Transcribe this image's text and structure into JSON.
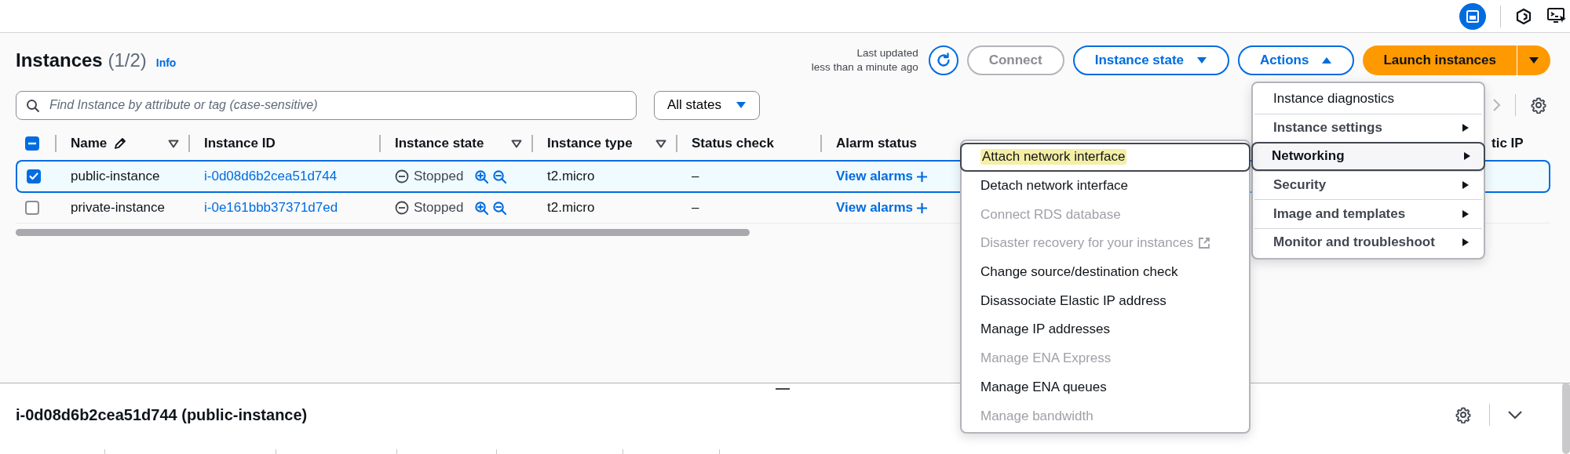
{
  "header": {
    "title": "Instances",
    "count": "(1/2)",
    "info": "Info",
    "last_updated": [
      "Last updated",
      "less than a minute ago"
    ]
  },
  "toolbar": {
    "connect": {
      "label": "Connect",
      "disabled": true
    },
    "instance_state": {
      "label": "Instance state",
      "expanded": false
    },
    "actions": {
      "label": "Actions",
      "expanded": true
    },
    "launch": {
      "label": "Launch instances"
    }
  },
  "search": {
    "placeholder": "Find Instance by attribute or tag (case-sensitive)"
  },
  "filter": {
    "label": "All states"
  },
  "table": {
    "select_all": {
      "indeterminate": true
    },
    "columns": [
      {
        "label": "Name",
        "sortable": true,
        "editable": true
      },
      {
        "label": "Instance ID",
        "sortable": false,
        "editable": false
      },
      {
        "label": "Instance state",
        "sortable": true,
        "editable": false
      },
      {
        "label": "Instance type",
        "sortable": true,
        "editable": false
      },
      {
        "label": "Status check",
        "sortable": false,
        "editable": false
      },
      {
        "label": "Alarm status",
        "sortable": false,
        "editable": false
      },
      {
        "label": "tic IP",
        "sortable": false,
        "editable": false
      }
    ],
    "rows": [
      {
        "selected": true,
        "name": "public-instance",
        "instance_id": "i-0d08d6b2cea51d744",
        "state": "Stopped",
        "type": "t2.micro",
        "status_check": "–",
        "alarm": "View alarms"
      },
      {
        "selected": false,
        "name": "private-instance",
        "instance_id": "i-0e161bbb37371d7ed",
        "state": "Stopped",
        "type": "t2.micro",
        "status_check": "–",
        "alarm": "View alarms"
      }
    ]
  },
  "actions_menu": {
    "items": [
      {
        "label": "Instance diagnostics",
        "has_submenu": false,
        "selected": false
      },
      {
        "label": "Instance settings",
        "has_submenu": true,
        "selected": false
      },
      {
        "label": "Networking",
        "has_submenu": true,
        "selected": true
      },
      {
        "label": "Security",
        "has_submenu": true,
        "selected": false
      },
      {
        "label": "Image and templates",
        "has_submenu": true,
        "selected": false
      },
      {
        "label": "Monitor and troubleshoot",
        "has_submenu": true,
        "selected": false
      }
    ]
  },
  "submenu": {
    "items": [
      {
        "label": "Attach network interface",
        "disabled": false,
        "selected": true,
        "highlighted": true,
        "external": false
      },
      {
        "label": "Detach network interface",
        "disabled": false,
        "selected": false,
        "highlighted": false,
        "external": false
      },
      {
        "label": "Connect RDS database",
        "disabled": true,
        "selected": false,
        "highlighted": false,
        "external": false
      },
      {
        "label": "Disaster recovery for your instances",
        "disabled": true,
        "selected": false,
        "highlighted": false,
        "external": true
      },
      {
        "label": "Change source/destination check",
        "disabled": false,
        "selected": false,
        "highlighted": false,
        "external": false
      },
      {
        "label": "Disassociate Elastic IP address",
        "disabled": false,
        "selected": false,
        "highlighted": false,
        "external": false
      },
      {
        "label": "Manage IP addresses",
        "disabled": false,
        "selected": false,
        "highlighted": false,
        "external": false
      },
      {
        "label": "Manage ENA Express",
        "disabled": true,
        "selected": false,
        "highlighted": false,
        "external": false
      },
      {
        "label": "Manage ENA queues",
        "disabled": false,
        "selected": false,
        "highlighted": false,
        "external": false
      },
      {
        "label": "Manage bandwidth",
        "disabled": true,
        "selected": false,
        "highlighted": false,
        "external": false
      }
    ]
  },
  "details": {
    "title": "i-0d08d6b2cea51d744 (public-instance)"
  }
}
